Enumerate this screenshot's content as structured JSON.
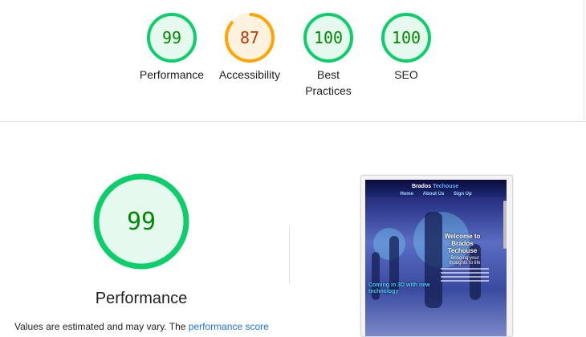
{
  "summary_gauges": [
    {
      "score": "99",
      "label": "Performance",
      "color": "#0cce6b",
      "track": "#e6f9ee",
      "text_color": "#008800",
      "fraction": 0.99
    },
    {
      "score": "87",
      "label": "Accessibility",
      "color": "#ffa400",
      "track": "#fff3e0",
      "text_color": "#c33300",
      "fraction": 0.87
    },
    {
      "score": "100",
      "label": "Best Practices",
      "color": "#0cce6b",
      "track": "#e6f9ee",
      "text_color": "#008800",
      "fraction": 1.0
    },
    {
      "score": "100",
      "label": "SEO",
      "color": "#0cce6b",
      "track": "#e6f9ee",
      "text_color": "#008800",
      "fraction": 1.0
    }
  ],
  "performance": {
    "score": "99",
    "title": "Performance",
    "note_text": "Values are estimated and may vary. The ",
    "note_link": "performance score"
  },
  "screenshot": {
    "brand": "Brados",
    "brand_accent": "Techouse",
    "nav": [
      "Home",
      "About Us",
      "Sign Up"
    ],
    "hero_line1": "Welcome to",
    "hero_line2": "Brados",
    "hero_line3": "Techouse",
    "sub": "Bringing your thoughts to life",
    "coming": "Coming in 3D with new technology"
  }
}
